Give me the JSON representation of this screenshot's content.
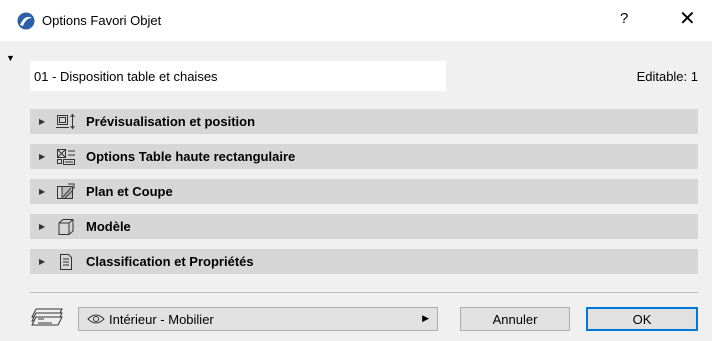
{
  "window": {
    "title": "Options Favori Objet",
    "help_glyph": "?",
    "close_glyph": "✕",
    "icon": "archicad-logo-icon"
  },
  "name_field": {
    "value": "01 - Disposition table et chaises"
  },
  "editable_label": "Editable: 1",
  "panels": [
    {
      "label": "Prévisualisation et position",
      "icon": "preview-position-icon"
    },
    {
      "label": "Options Table haute rectangulaire",
      "icon": "object-settings-icon"
    },
    {
      "label": "Plan et Coupe",
      "icon": "floorplan-section-icon"
    },
    {
      "label": "Modèle",
      "icon": "3d-model-icon"
    },
    {
      "label": "Classification et Propriétés",
      "icon": "classification-icon"
    }
  ],
  "footer": {
    "layer_icon": "layer-icon",
    "layer_value": "Intérieur - Mobilier",
    "cancel_label": "Annuler",
    "ok_label": "OK"
  },
  "colors": {
    "accent": "#0078d7",
    "panel_bg": "#d6d6d6",
    "dialog_bg": "#f0f0f0"
  }
}
